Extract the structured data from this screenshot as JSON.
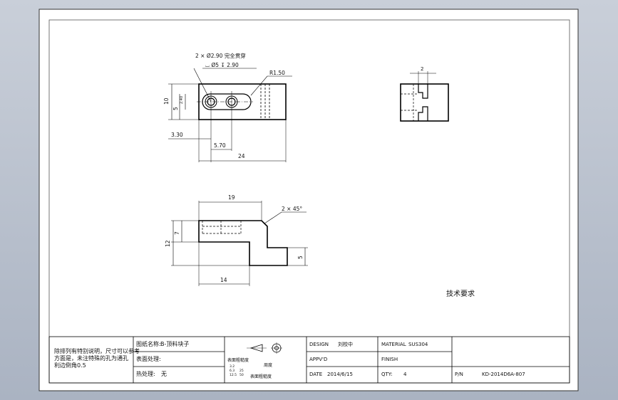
{
  "title_block": {
    "tech_note_lines": [
      "除排列有特别说明，尺寸可以参考",
      "方面是，未注特殊的孔为通孔",
      "利边倒角0.5"
    ],
    "part_name_label": "图纸名称:",
    "part_name_value": "B-顶料块子",
    "surface_label": "表面处理:",
    "heat_label": "热处理:",
    "heat_value": "无",
    "roughness_label": "表面粗糙度",
    "roughness_vals": [
      "3.2",
      "6.3",
      "12.5",
      "25",
      "50"
    ],
    "roughness_side": "周度",
    "roughness_bottom": "表面粗糙度",
    "design_label": "DESIGN",
    "design_value": "刘校中",
    "material_label": "MATERIAL",
    "material_value": "SUS304",
    "appvd_label": "APPV'D",
    "finish_label": "FINISH",
    "date_label": "DATE",
    "date_value": "2014/6/15",
    "qty_label": "QTY:",
    "qty_value": "4",
    "pn_label": "P/N",
    "pn_value": "KD-2014D6A-807"
  },
  "annotations": {
    "hole_note_1": "2 × Ø2.90 完全贯穿",
    "hole_note_2": "⌴ Ø5 ↧ 2.90",
    "radius": "R1.50",
    "dim_10": "10",
    "dim_5v": "5",
    "dim_small": "2.40",
    "dim_330": "3.30",
    "dim_570": "5.70",
    "dim_24": "24",
    "dim_2": "2",
    "dim_19": "19",
    "chamfer": "2 × 45°",
    "dim_7": "7",
    "dim_12": "12",
    "dim_5": "5",
    "dim_14": "14",
    "tech_req": "技术要求"
  },
  "colors": {
    "line": "#000000",
    "paper": "#ffffff",
    "frame": "#333333"
  }
}
